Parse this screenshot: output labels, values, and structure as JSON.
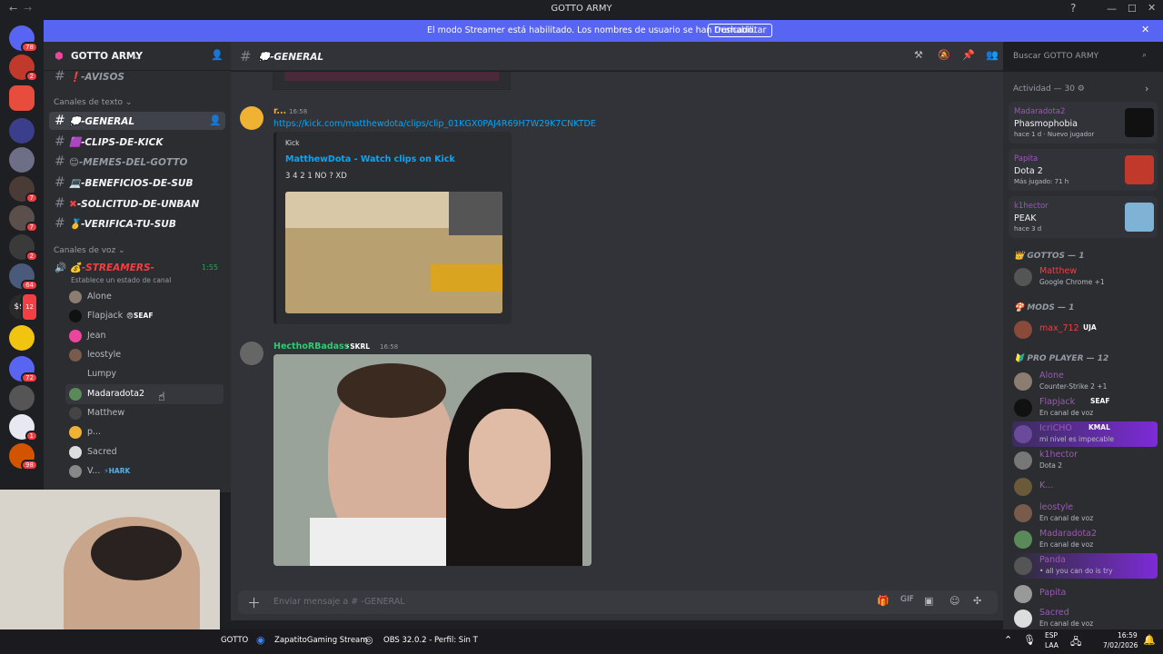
{
  "window": {
    "title": "GOTTO ARMY"
  },
  "banner": {
    "text": "El modo Streamer está habilitado. Los nombres de usuario se han truncado.",
    "button": "Deshabilitar"
  },
  "guilds": {
    "badges": [
      "78",
      "2",
      "7",
      "7",
      "2",
      "64",
      "12",
      "72",
      "1",
      "98"
    ]
  },
  "server": {
    "name": "GOTTO ARMY"
  },
  "channels": {
    "avisos": "-AVISOS",
    "text_category": "Canales de texto",
    "items": [
      "-GENERAL",
      "-CLIPS-DE-KICK",
      "-MEMES-DEL-GOTTO",
      "-BENEFICIOS-DE-SUB",
      "-SOLICITUD-DE-UNBAN",
      "-VERIFICA-TU-SUB"
    ],
    "voice_category": "Canales de voz",
    "voice_channel": "-STREAMERS-",
    "voice_time": "1:55",
    "voice_status": "Establece un estado de canal"
  },
  "voice_users": [
    {
      "name": "Alone",
      "tag": ""
    },
    {
      "name": "Flapjack",
      "tag": "SEAF"
    },
    {
      "name": "Jean",
      "tag": ""
    },
    {
      "name": "leostyle",
      "tag": ""
    },
    {
      "name": "Lumpy",
      "tag": ""
    },
    {
      "name": "Madaradota2",
      "tag": ""
    },
    {
      "name": "Matthew",
      "tag": ""
    },
    {
      "name": "p...",
      "tag": ""
    },
    {
      "name": "Sacred",
      "tag": ""
    },
    {
      "name": "V...",
      "tag": "HARK"
    }
  ],
  "chat": {
    "channel": "-GENERAL",
    "msg1": {
      "author": "r...",
      "time": "16:58",
      "link": "https://kick.com/matthewdota/clips/clip_01KGX0PAJ4R69H7W29K7CNKTDE",
      "provider": "Kick",
      "embed_title": "MatthewDota - Watch clips on Kick",
      "embed_desc": "3 4 2 1 NO ? XD"
    },
    "msg2": {
      "author": "HecthoRBadass",
      "tag": "SKRL",
      "time": "16:58"
    },
    "input_placeholder": "Enviar mensaje a # -GENERAL"
  },
  "search": {
    "placeholder": "Buscar GOTTO ARMY"
  },
  "activity": {
    "header": "Actividad — 30",
    "cards": [
      {
        "user": "Madaradota2",
        "game": "Phasmophobia",
        "meta": "hace 1 d · Nuevo jugador"
      },
      {
        "user": "Papita",
        "game": "Dota 2",
        "meta": "Más jugado: 71 h"
      },
      {
        "user": "k1hector",
        "game": "PEAK",
        "meta": "hace 3 d"
      }
    ]
  },
  "members": {
    "sections": [
      {
        "title": "GOTTOS — 1"
      },
      {
        "title": "MODS — 1"
      },
      {
        "title": "PRO PLAYER — 12"
      }
    ],
    "list": [
      {
        "name": "Matthew",
        "status": "Google Chrome +1",
        "color": "#f23f43"
      },
      {
        "name": "max_712",
        "status": "",
        "color": "#f23f43",
        "tag": "UJA"
      },
      {
        "name": "Alone",
        "status": "Counter-Strike 2 +1",
        "color": "#9b59b6"
      },
      {
        "name": "Flapjack",
        "status": "En canal de voz",
        "color": "#9b59b6",
        "tag": "SEAF"
      },
      {
        "name": "IcriCHO",
        "status": "mi nivel es impecable",
        "color": "#9b59b6",
        "tag": "KMAL"
      },
      {
        "name": "k1hector",
        "status": "Dota 2",
        "color": "#9b59b6"
      },
      {
        "name": "K...",
        "status": "",
        "color": "#9b59b6"
      },
      {
        "name": "leostyle",
        "status": "En canal de voz",
        "color": "#9b59b6"
      },
      {
        "name": "Madaradota2",
        "status": "En canal de voz",
        "color": "#9b59b6"
      },
      {
        "name": "Panda",
        "status": "• all you can do is try",
        "color": "#9b59b6"
      },
      {
        "name": "Papita",
        "status": "",
        "color": "#9b59b6"
      },
      {
        "name": "Sacred",
        "status": "En canal de voz",
        "color": "#9b59b6"
      }
    ]
  },
  "taskbar": {
    "items": [
      "GOTTO",
      "ZapatitoGaming Stream",
      "OBS 32.0.2 - Perfil: Sin T"
    ],
    "lang1": "ESP",
    "lang2": "LAA",
    "time": "16:59",
    "date": "7/02/2026"
  }
}
